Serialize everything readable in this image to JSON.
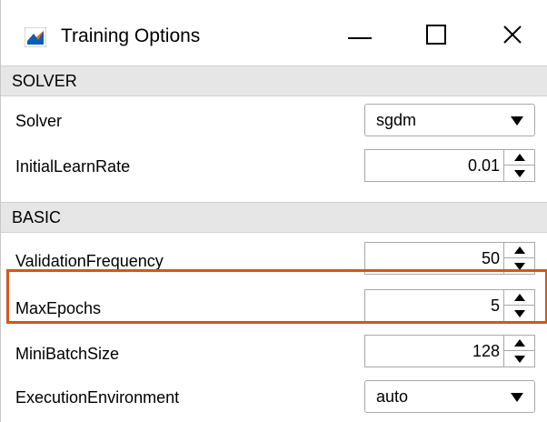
{
  "window": {
    "title": "Training Options",
    "minimize_icon": "minimize-icon",
    "maximize_icon": "maximize-icon",
    "close_icon": "close-icon",
    "app_icon": "matlab-icon"
  },
  "sections": {
    "solver": {
      "label": "SOLVER",
      "rows": {
        "solver": {
          "label": "Solver",
          "value": "sgdm"
        },
        "initial_learn_rate": {
          "label": "InitialLearnRate",
          "value": "0.01"
        }
      }
    },
    "basic": {
      "label": "BASIC",
      "rows": {
        "validation_frequency": {
          "label": "ValidationFrequency",
          "value": "50"
        },
        "max_epochs": {
          "label": "MaxEpochs",
          "value": "5"
        },
        "mini_batch_size": {
          "label": "MiniBatchSize",
          "value": "128"
        },
        "execution_environment": {
          "label": "ExecutionEnvironment",
          "value": "auto"
        }
      }
    }
  },
  "colors": {
    "highlight": "#d4561b",
    "section_bg": "#e6e6e6"
  }
}
